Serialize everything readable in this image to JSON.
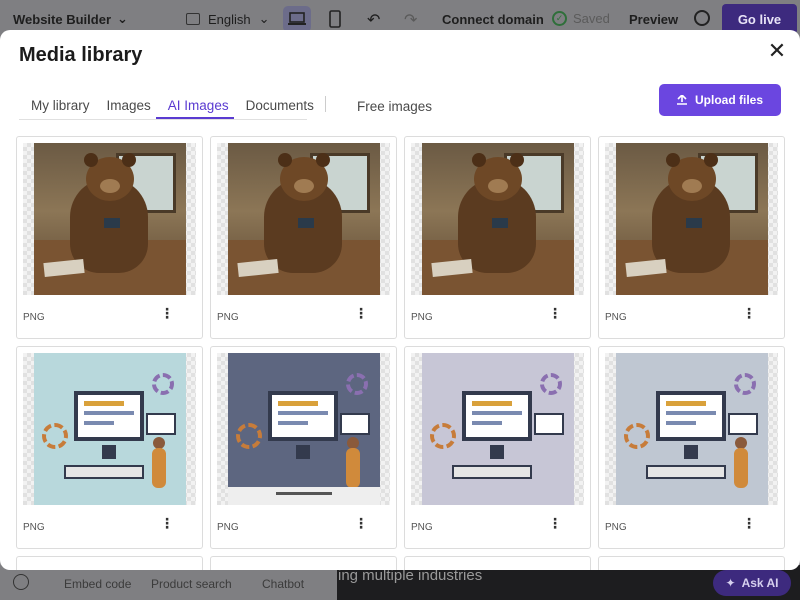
{
  "app": {
    "brand": "Website Builder",
    "language": "English",
    "connect_domain": "Connect domain",
    "saved": "Saved",
    "preview": "Preview",
    "go_live": "Go live"
  },
  "bottom": {
    "embed_code": "Embed code",
    "product_search": "Product search",
    "chatbot": "Chatbot",
    "background_text": "ing multiple industries",
    "ask_ai": "Ask AI"
  },
  "modal": {
    "title": "Media library",
    "tabs": [
      {
        "label": "My library",
        "active": false
      },
      {
        "label": "Images",
        "active": false
      },
      {
        "label": "AI Images",
        "active": true
      },
      {
        "label": "Documents",
        "active": false
      }
    ],
    "free_images": "Free images",
    "upload_button": "Upload files"
  },
  "media": [
    {
      "format": "PNG",
      "kind": "bear"
    },
    {
      "format": "PNG",
      "kind": "bear"
    },
    {
      "format": "PNG",
      "kind": "bear"
    },
    {
      "format": "PNG",
      "kind": "bear"
    },
    {
      "format": "PNG",
      "kind": "infographic"
    },
    {
      "format": "PNG",
      "kind": "infographic"
    },
    {
      "format": "PNG",
      "kind": "infographic"
    },
    {
      "format": "PNG",
      "kind": "infographic"
    }
  ],
  "colors": {
    "accent": "#6b46e0",
    "active_tab": "#5a3bd1"
  }
}
